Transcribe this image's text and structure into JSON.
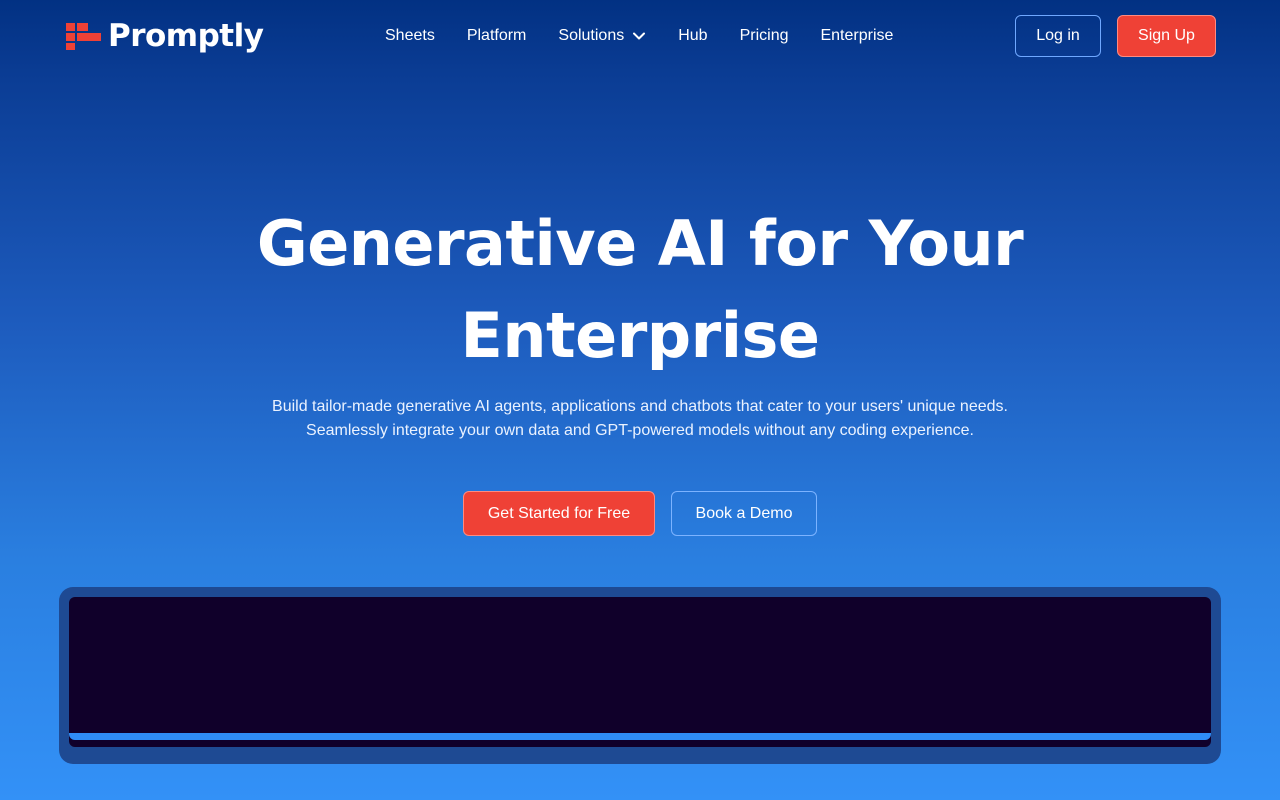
{
  "brand": {
    "name": "Promptly",
    "logo_icon": "promptly-logo-icon",
    "accent_color": "#ef4136"
  },
  "nav": {
    "items": [
      {
        "label": "Sheets"
      },
      {
        "label": "Platform"
      },
      {
        "label": "Solutions",
        "icon": "chevron-down-icon"
      },
      {
        "label": "Hub"
      },
      {
        "label": "Pricing"
      },
      {
        "label": "Enterprise"
      }
    ],
    "login_label": "Log in",
    "signup_label": "Sign Up"
  },
  "hero": {
    "title": "Generative AI for Your Enterprise",
    "subtitle_line1": "Build tailor-made generative AI agents, applications and chatbots that cater to your users' unique needs.",
    "subtitle_line2": "Seamlessly integrate your own data and GPT-powered models without any coding experience.",
    "primary_cta": "Get Started for Free",
    "secondary_cta": "Book a Demo"
  },
  "media": {
    "screen_color": "#10002a",
    "frame_color": "#1e4a93"
  }
}
